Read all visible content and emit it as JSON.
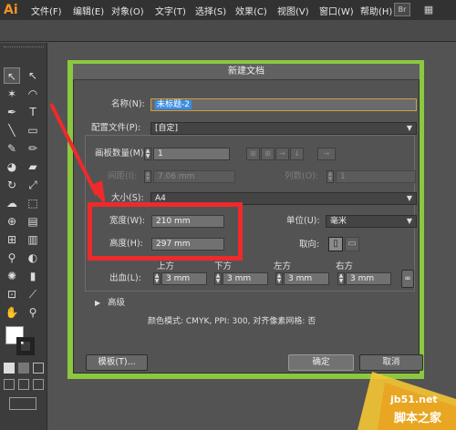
{
  "app": {
    "logo": "Ai",
    "menus": [
      "文件(F)",
      "编辑(E)",
      "对象(O)",
      "文字(T)",
      "选择(S)",
      "效果(C)",
      "视图(V)",
      "窗口(W)",
      "帮助(H)"
    ],
    "bridge_label": "Br"
  },
  "dialog": {
    "title": "新建文档",
    "name_label": "名称(N):",
    "name_value": "未标题-2",
    "profile_label": "配置文件(P):",
    "profile_value": "[自定]",
    "artboards_label": "画板数量(M):",
    "artboards_value": "1",
    "spacing_label": "间距(I):",
    "spacing_value": "7.06 mm",
    "columns_label": "列数(O):",
    "columns_value": "1",
    "size_label": "大小(S):",
    "size_value": "A4",
    "width_label": "宽度(W):",
    "width_value": "210 mm",
    "units_label": "单位(U):",
    "units_value": "毫米",
    "height_label": "高度(H):",
    "height_value": "297 mm",
    "orientation_label": "取向:",
    "bleed_label": "出血(L):",
    "bleed_top_label": "上方",
    "bleed_bottom_label": "下方",
    "bleed_left_label": "左方",
    "bleed_right_label": "右方",
    "bleed_top": "3 mm",
    "bleed_bottom": "3 mm",
    "bleed_left": "3 mm",
    "bleed_right": "3 mm",
    "advanced_label": "高级",
    "info_text": "颜色模式: CMYK, PPI: 300, 对齐像素网格: 否",
    "templates_button": "模板(T)...",
    "ok_button": "确定",
    "cancel_button": "取消"
  },
  "watermark": {
    "line1": "jb51.net",
    "line2": "脚本之家"
  },
  "colors": {
    "accent_green": "#8cc83f",
    "highlight_red": "#ee2a2a",
    "selection_blue": "#3a8ee6",
    "logo_orange": "#f09427"
  }
}
